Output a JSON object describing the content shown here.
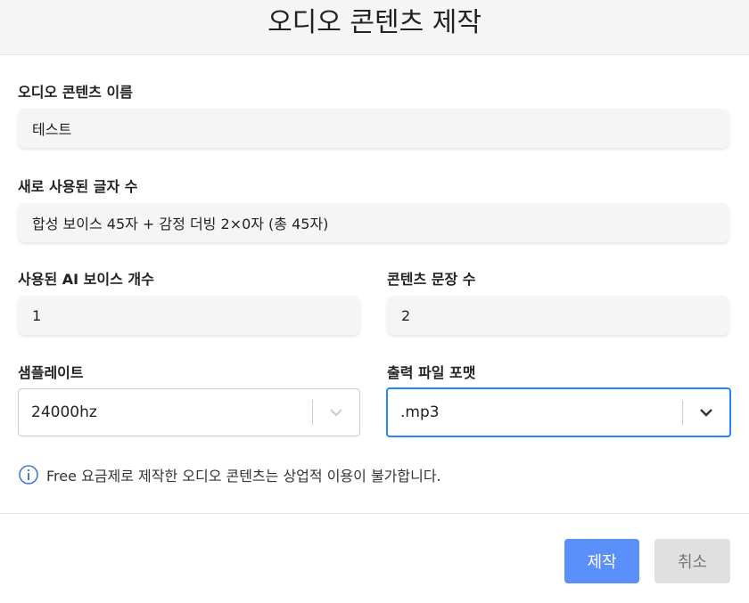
{
  "dialog": {
    "title": "오디오 콘텐츠 제작"
  },
  "fields": {
    "content_name": {
      "label": "오디오 콘텐츠 이름",
      "value": "테스트"
    },
    "new_chars": {
      "label": "새로 사용된 글자 수",
      "value": "합성 보이스 45자 + 감정 더빙 2×0자 (총 45자)"
    },
    "ai_voice_count": {
      "label": "사용된 AI 보이스 개수",
      "value": "1"
    },
    "sentence_count": {
      "label": "콘텐츠 문장 수",
      "value": "2"
    },
    "sample_rate": {
      "label": "샘플레이트",
      "selected": "24000hz"
    },
    "output_format": {
      "label": "출력 파일 포맷",
      "selected": ".mp3"
    }
  },
  "notice": {
    "icon": "info-icon",
    "text": "Free 요금제로 제작한 오디오 콘텐츠는 상업적 이용이 불가합니다."
  },
  "buttons": {
    "create": "제작",
    "cancel": "취소"
  },
  "colors": {
    "primary": "#5b8ff9",
    "focus": "#2684ff",
    "info": "#3d7bd9",
    "field_bg": "#f5f5f5"
  }
}
